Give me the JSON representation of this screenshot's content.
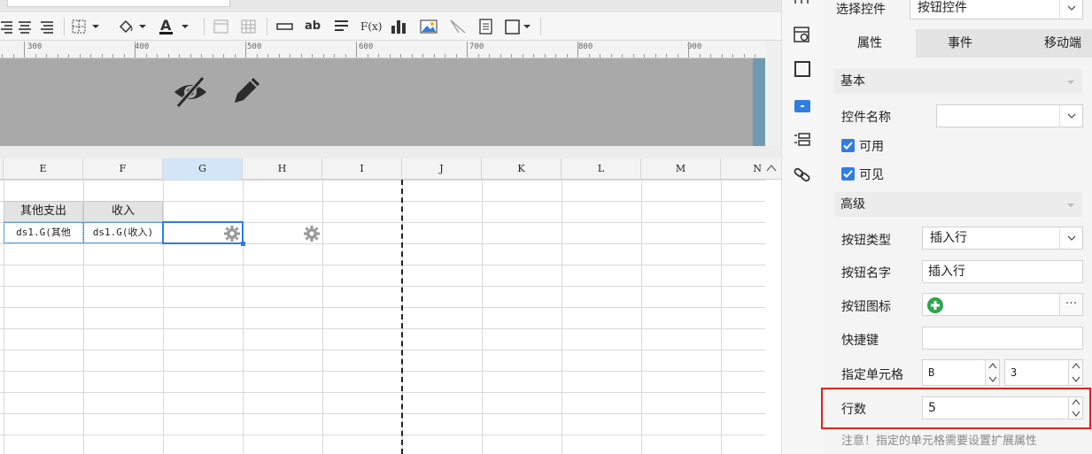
{
  "toolbar": {
    "icons": [
      "align-right-icon",
      "align-center-icon",
      "align-justify-icon",
      "border-icon",
      "fill-color-icon",
      "font-color-icon",
      "freeze-icon",
      "grid-icon",
      "textbox-icon",
      "ab-text-icon",
      "list-icon",
      "formula-icon",
      "bar-chart-icon",
      "image-icon",
      "slash-icon",
      "doc-icon",
      "border-style-icon"
    ],
    "formula_label": "F(x)",
    "ab_label": "ab"
  },
  "ruler": {
    "labels": [
      "300",
      "400",
      "500",
      "600",
      "700",
      "800",
      "900"
    ]
  },
  "preview": {
    "icons": [
      "eye-off-icon",
      "pencil-icon"
    ]
  },
  "columns": [
    "E",
    "F",
    "G",
    "H",
    "I",
    "J",
    "K",
    "L",
    "M",
    "N"
  ],
  "table": {
    "header": [
      "其他支出",
      "收入"
    ],
    "row": [
      "ds1.G(其他",
      "ds1.G(收入)"
    ]
  },
  "panel": {
    "choose_label": "选择控件",
    "choose_value": "按钮控件",
    "tabs": [
      "属性",
      "事件",
      "移动端"
    ],
    "section_basic": "基本",
    "name_label": "控件名称",
    "name_value": "",
    "enabled_label": "可用",
    "visible_label": "可见",
    "section_advanced": "高级",
    "btn_type_label": "按钮类型",
    "btn_type_value": "插入行",
    "btn_name_label": "按钮名字",
    "btn_name_value": "插入行",
    "btn_icon_label": "按钮图标",
    "more_label": "···",
    "shortcut_label": "快捷键",
    "shortcut_value": "",
    "cell_label": "指定单元格",
    "cell_col": "B",
    "cell_row": "3",
    "rows_label": "行数",
    "rows_value": "5",
    "note": "注意！指定的单元格需要设置扩展属性"
  },
  "colors": {
    "accent": "#2f7de1",
    "highlight": "#e02020",
    "green": "#2ea44f"
  }
}
